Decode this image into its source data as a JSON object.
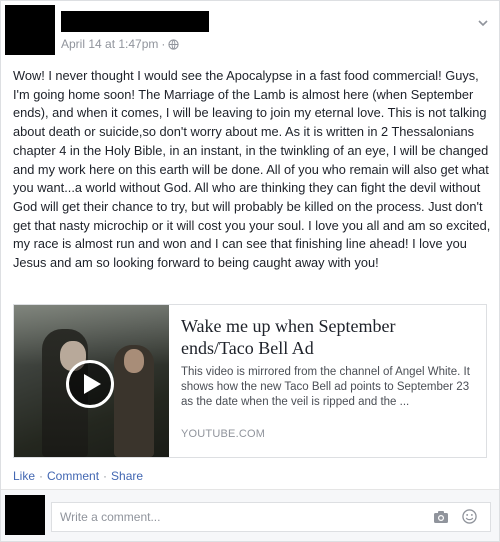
{
  "post": {
    "timestamp": "April 14 at 1:47pm",
    "separator": "·",
    "privacy_icon": "globe-icon",
    "menu_icon": "chevron-down-icon",
    "text": "Wow! I never thought I would see the Apocalypse in a fast food commercial! Guys, I'm going home soon! The Marriage of the Lamb is almost here (when September ends), and when it comes, I will be leaving to join my eternal love. This is not talking about death or suicide,so don't worry about me. As it is written in 2 Thessalonians chapter 4 in the Holy Bible, in an instant, in the twinkling of an eye, I will be changed and my work here on this earth will be done. All of you who remain will also get what you want...a world without God. All who are thinking they can fight the devil without God will get their chance to try, but will probably be killed on the process. Just don't get that nasty microchip or it will cost you your soul. I love you all and am so excited, my race is almost run and won and I can see that finishing line ahead! I love you Jesus and am so looking forward to being caught away with you!"
  },
  "link_card": {
    "title": "Wake me up when September ends/Taco Bell Ad",
    "description": "This video is mirrored from the channel of Angel White. It shows how the new Taco Bell ad points to September 23 as the date when the veil is ripped and the ...",
    "source": "YOUTUBE.COM",
    "thumbnail_icon": "play-icon"
  },
  "actions": {
    "like": "Like",
    "comment": "Comment",
    "share": "Share",
    "dot": "·"
  },
  "comment_box": {
    "placeholder": "Write a comment...",
    "camera_icon": "camera-icon",
    "emoji_icon": "emoji-icon"
  },
  "colors": {
    "link_blue": "#4267b2",
    "meta_gray": "#90949c",
    "text": "#1d2129"
  }
}
